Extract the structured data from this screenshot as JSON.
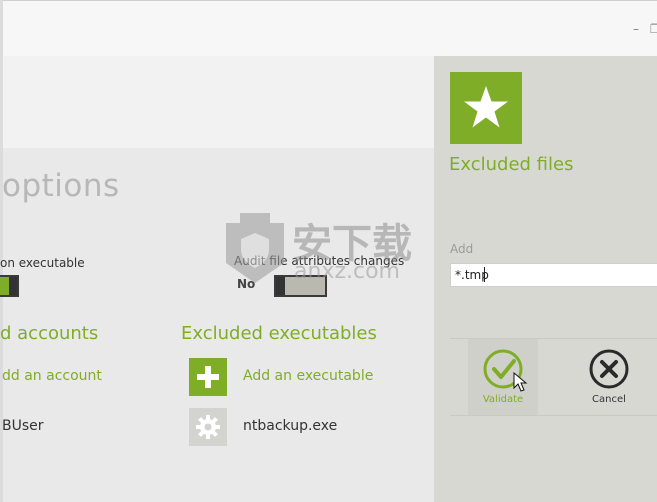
{
  "window": {
    "minimize_glyph": "–",
    "restore_glyph": "❐"
  },
  "main": {
    "title_fragment": "options",
    "setting_left_label": "on executable",
    "setting_right_label": "Audit file attributes changes",
    "setting_right_value": "No",
    "sections": {
      "accounts": {
        "title": "d accounts",
        "add_link": "dd an account",
        "items": [
          "BUser"
        ]
      },
      "executables": {
        "title": "Excluded executables",
        "add_link": "Add an executable",
        "items": [
          "ntbackup.exe"
        ]
      }
    },
    "watermark_text": "安下载",
    "watermark_sub": "anxz.com"
  },
  "panel": {
    "title": "Excluded files",
    "add_label": "Add",
    "add_value": "*.tmp",
    "validate_label": "Validate",
    "cancel_label": "Cancel"
  },
  "colors": {
    "accent": "#7fad27",
    "panel_bg": "#d8d8d3",
    "main_bg": "#e9e9e9"
  },
  "icons": [
    "star-icon",
    "plus-icon",
    "gear-icon",
    "checkmark-icon",
    "close-icon",
    "cursor-icon",
    "shield-watermark-icon"
  ]
}
